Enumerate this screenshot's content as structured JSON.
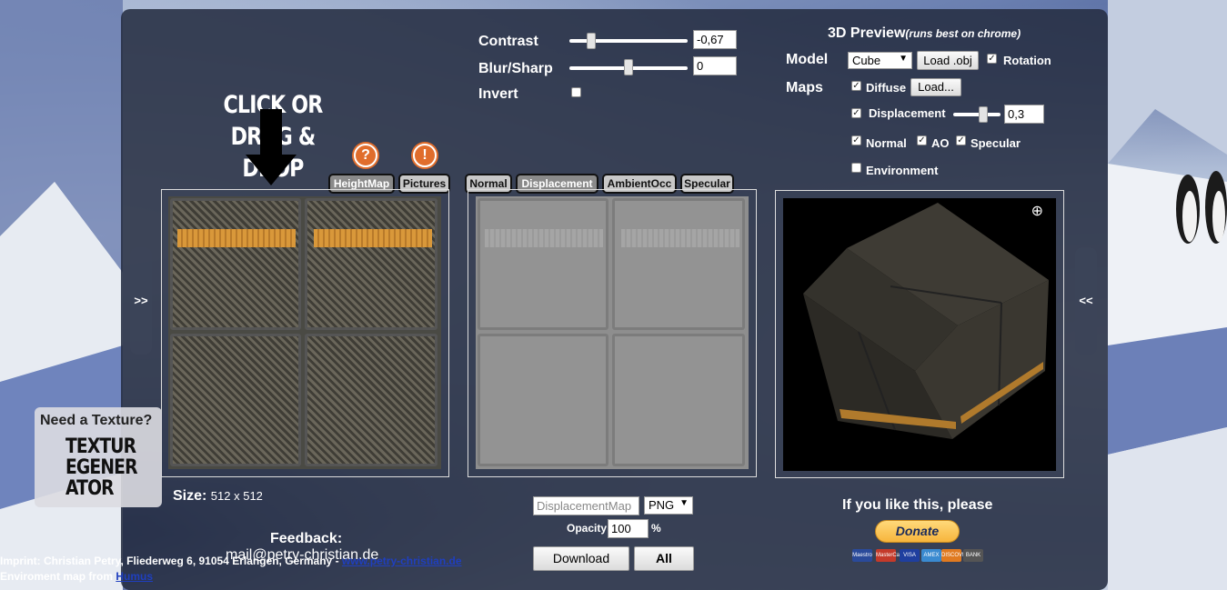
{
  "controls": {
    "contrast_label": "Contrast",
    "contrast_value": "-0,67",
    "blur_label": "Blur/Sharp",
    "blur_value": "0",
    "invert_label": "Invert"
  },
  "preview": {
    "title": "3D Preview",
    "title_note": "(runs best on chrome)",
    "model_label": "Model",
    "model_selected": "Cube",
    "load_obj_label": "Load .obj",
    "rotation_label": "Rotation",
    "maps_label": "Maps",
    "diffuse_label": "Diffuse",
    "diffuse_load_label": "Load...",
    "displacement_label": "Displacement",
    "displacement_value": "0,3",
    "normal_label": "Normal",
    "ao_label": "AO",
    "specular_label": "Specular",
    "environment_label": "Environment"
  },
  "dropzone": {
    "line1": "CLICK OR",
    "line2": "DRAG & DROP"
  },
  "hints": {
    "help_icon": "?",
    "warning_icon": "!"
  },
  "tabs": {
    "left": [
      "HeightMap",
      "Pictures"
    ],
    "right": [
      "Normal",
      "Displacement",
      "AmbientOcc",
      "Specular"
    ]
  },
  "nav": {
    "expand_left": ">>",
    "collapse_right": "<<"
  },
  "size": {
    "label": "Size:",
    "value": "512 x 512"
  },
  "export": {
    "filename": "DisplacementMap",
    "format": "PNG",
    "opacity_label": "Opacity",
    "opacity_value": "100",
    "opacity_unit": "%",
    "download_label": "Download",
    "all_label": "All"
  },
  "feedback": {
    "label": "Feedback:",
    "email": "mail@petry-christian.de"
  },
  "donate": {
    "text": "If you like this, please",
    "button_label": "Donate",
    "cards": [
      "Maestro",
      "MasterCard",
      "VISA",
      "AMEX",
      "DISCOVER",
      "BANK"
    ]
  },
  "promo": {
    "title": "Need a Texture?",
    "logo_line1": "TEXTUR",
    "logo_line2": "EGENER",
    "logo_line3": "ATOR"
  },
  "footer": {
    "imprint_text": "Imprint: Christian Petry, Fliederweg 6, 91054 Erlangen, Germany - ",
    "imprint_link": "www.petry-christian.de",
    "envmap_text": "Enviroment map from ",
    "envmap_link": "Humus"
  },
  "colors": {
    "panel": "#262e42",
    "hint_orange": "#e06d2c",
    "donate_gold": "#f7b53c",
    "tab_active": "#8a8a8a"
  }
}
